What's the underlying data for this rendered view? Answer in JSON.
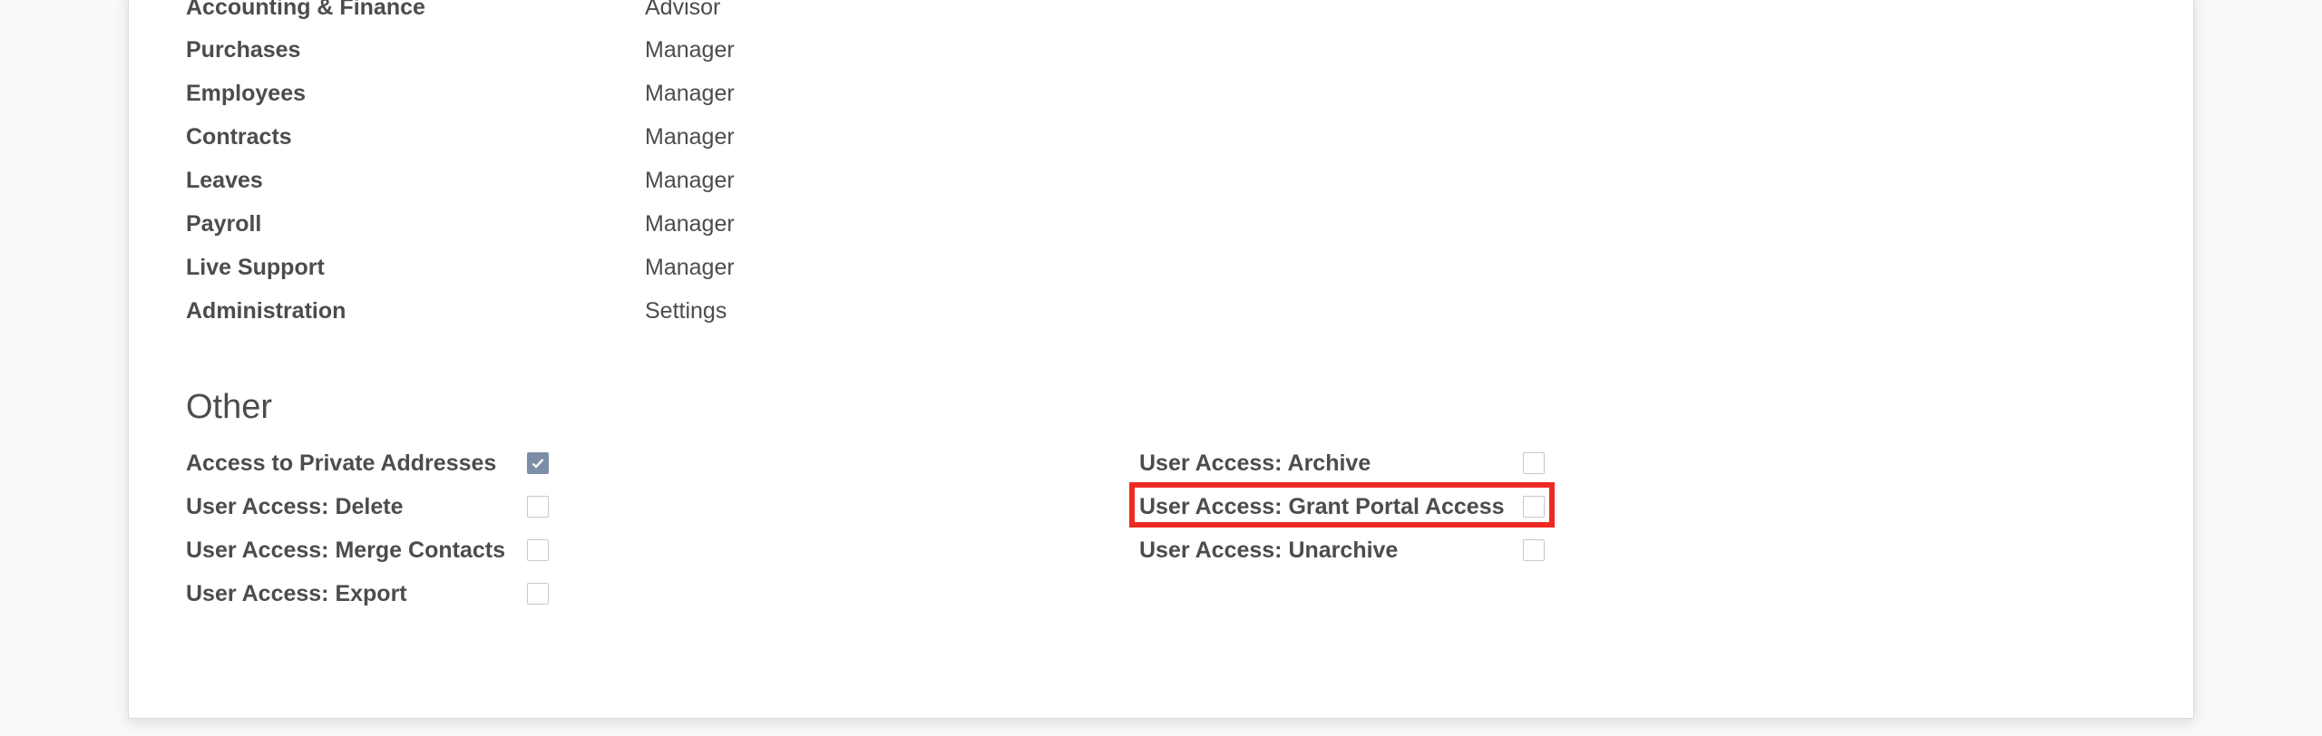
{
  "groups": [
    {
      "app": "Accounting & Finance",
      "role": "Advisor"
    },
    {
      "app": "Purchases",
      "role": "Manager"
    },
    {
      "app": "Employees",
      "role": "Manager"
    },
    {
      "app": "Contracts",
      "role": "Manager"
    },
    {
      "app": "Leaves",
      "role": "Manager"
    },
    {
      "app": "Payroll",
      "role": "Manager"
    },
    {
      "app": "Live Support",
      "role": "Manager"
    },
    {
      "app": "Administration",
      "role": "Settings"
    }
  ],
  "other": {
    "title": "Other",
    "left": [
      {
        "label": "Access to Private Addresses",
        "checked": true
      },
      {
        "label": "User Access: Delete",
        "checked": false
      },
      {
        "label": "User Access: Merge Contacts",
        "checked": false
      },
      {
        "label": "User Access: Export",
        "checked": false
      }
    ],
    "right": [
      {
        "label": "User Access: Archive",
        "checked": false
      },
      {
        "label": "User Access: Grant Portal Access",
        "checked": false
      },
      {
        "label": "User Access: Unarchive",
        "checked": false
      }
    ]
  },
  "colors": {
    "highlight": "#ee2a24",
    "checked": "#7c8ea6"
  }
}
